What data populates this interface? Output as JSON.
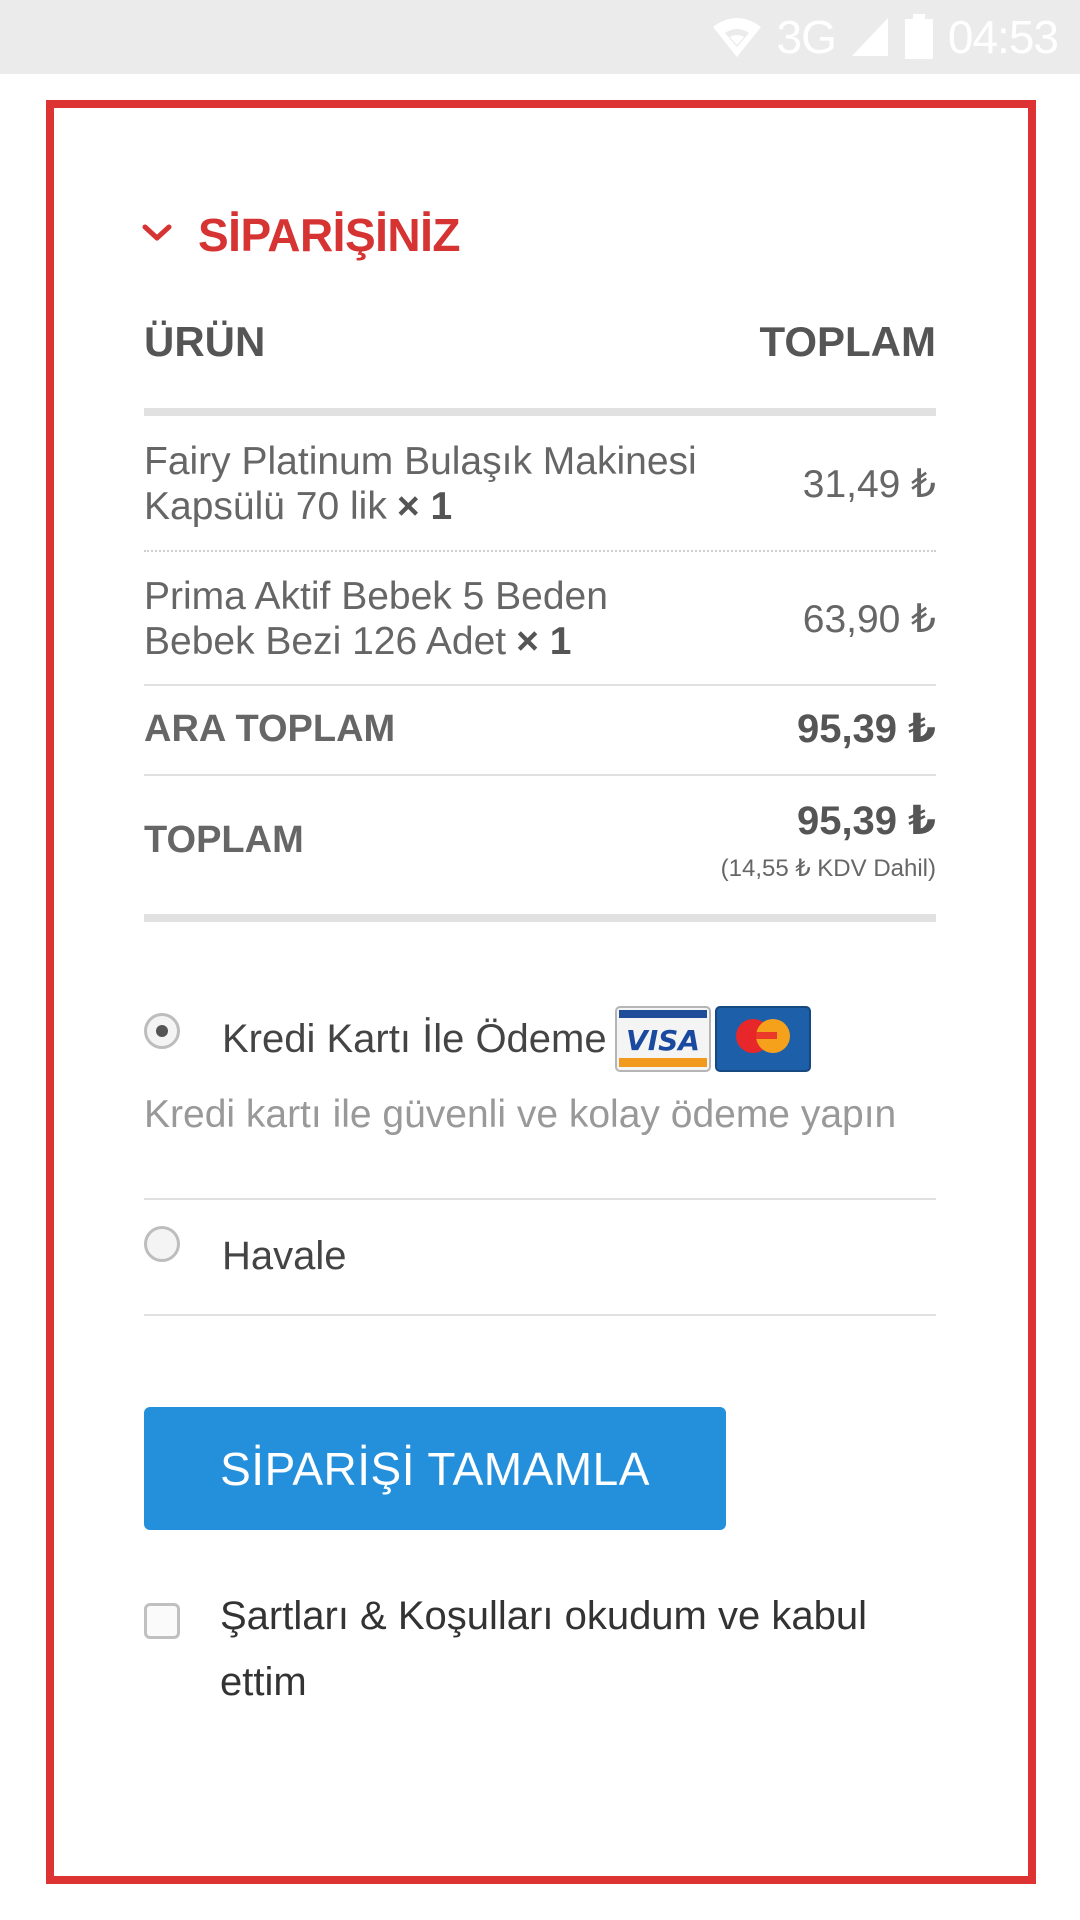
{
  "status_bar": {
    "network": "3G",
    "time": "04:53"
  },
  "checkout": {
    "title": "SİPARİŞİNİZ",
    "columns": {
      "product": "ÜRÜN",
      "total": "TOPLAM"
    },
    "items": [
      {
        "name": "Fairy Platinum Bulaşık Makinesi Kapsülü 70 lik",
        "qty": "× 1",
        "price": "31,49 ₺"
      },
      {
        "name": "Prima Aktif Bebek 5 Beden Bebek Bezi 126 Adet",
        "qty": "× 1",
        "price": "63,90 ₺"
      }
    ],
    "subtotal": {
      "label": "ARA TOPLAM",
      "value": "95,39 ₺"
    },
    "total": {
      "label": "TOPLAM",
      "value": "95,39 ₺",
      "tax_note": "(14,55 ₺ KDV Dahil)"
    }
  },
  "payment": {
    "options": [
      {
        "label": "Kredi Kartı İle Ödeme",
        "selected": true,
        "description": "Kredi kartı ile güvenli ve kolay ödeme yapın",
        "card_logos": [
          "VISA",
          "mastercard"
        ]
      },
      {
        "label": "Havale",
        "selected": false
      }
    ]
  },
  "submit_label": "SİPARİŞİ TAMAMLA",
  "terms_label": "Şartları & Koşulları okudum ve kabul ettim",
  "colors": {
    "accent_red": "#d63333",
    "button_blue": "#2490dc",
    "frame_red": "#dd3333"
  }
}
